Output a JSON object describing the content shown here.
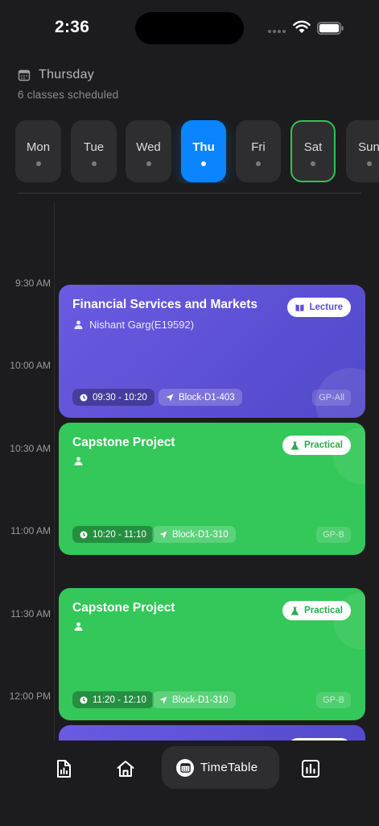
{
  "status_bar": {
    "time": "2:36"
  },
  "header": {
    "day": "Thursday",
    "subtitle": "6 classes scheduled"
  },
  "days": [
    {
      "label": "Mon",
      "state": "normal"
    },
    {
      "label": "Tue",
      "state": "normal"
    },
    {
      "label": "Wed",
      "state": "normal"
    },
    {
      "label": "Thu",
      "state": "selected"
    },
    {
      "label": "Fri",
      "state": "normal"
    },
    {
      "label": "Sat",
      "state": "today"
    },
    {
      "label": "Sun",
      "state": "normal"
    }
  ],
  "timeline": {
    "labels": [
      "9:30 AM",
      "10:00 AM",
      "10:30 AM",
      "11:00 AM",
      "11:30 AM",
      "12:00 PM"
    ]
  },
  "classes": [
    {
      "title": "Financial Services and Markets",
      "person": "Nishant Garg(E19592)",
      "type": "Lecture",
      "time": "09:30 - 10:20",
      "room": "Block-D1-403",
      "group": "GP-All"
    },
    {
      "title": "Capstone Project",
      "person": "",
      "type": "Practical",
      "time": "10:20 - 11:10",
      "room": "Block-D1-310",
      "group": "GP-B"
    },
    {
      "title": "Capstone Project",
      "person": "",
      "type": "Practical",
      "time": "11:20 - 12:10",
      "room": "Block-D1-310",
      "group": "GP-B"
    }
  ],
  "nav": {
    "active_label": "TimeTable"
  },
  "colors": {
    "accent": "#0a84ff",
    "lecture": "#5a4fd6",
    "practical": "#34c759",
    "today_border": "#2ec25a"
  }
}
